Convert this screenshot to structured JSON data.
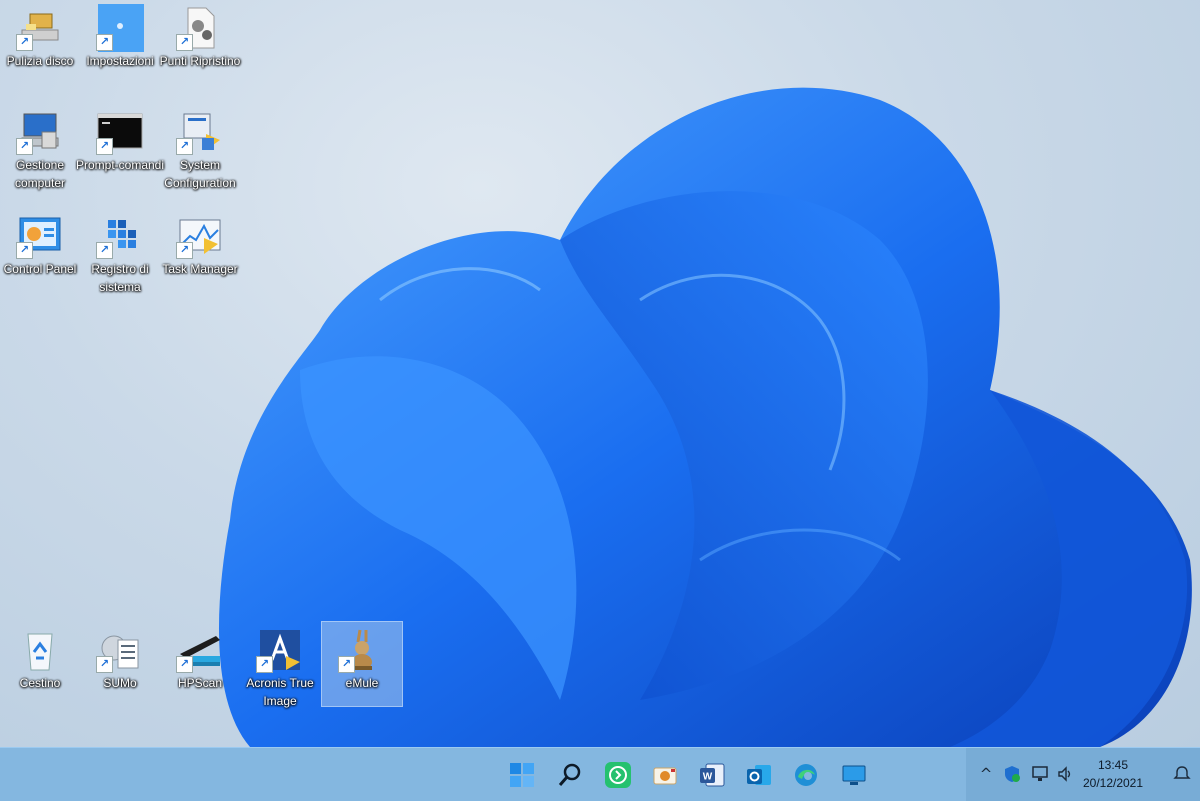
{
  "desktop": {
    "icons": [
      {
        "label": "Pulizia disco",
        "name": "disk-cleanup-icon"
      },
      {
        "label": "Impostazioni",
        "name": "settings-icon"
      },
      {
        "label": "Punti Ripristino",
        "name": "restore-points-icon"
      },
      {
        "label": "Gestione computer",
        "name": "computer-management-icon"
      },
      {
        "label": "Prompt-comandi",
        "name": "command-prompt-icon"
      },
      {
        "label": "System Configuration",
        "name": "system-configuration-icon"
      },
      {
        "label": "Control Panel",
        "name": "control-panel-icon"
      },
      {
        "label": "Registro di sistema",
        "name": "registry-editor-icon"
      },
      {
        "label": "Task Manager",
        "name": "task-manager-icon"
      },
      {
        "label": "Cestino",
        "name": "recycle-bin-icon"
      },
      {
        "label": "SUMo",
        "name": "sumo-icon"
      },
      {
        "label": "HPScan",
        "name": "hp-scan-icon"
      },
      {
        "label": "Acronis True Image",
        "name": "acronis-icon"
      },
      {
        "label": "eMule",
        "name": "emule-icon"
      }
    ],
    "shortcut_arrow": "↗"
  },
  "taskbar": {
    "apps": [
      "start-icon",
      "search-icon",
      "whatsapp-icon",
      "camera-app-icon",
      "word-icon",
      "outlook-icon",
      "edge-icon",
      "display-icon"
    ],
    "tray": {
      "chevron": "^",
      "time": "13:45",
      "date": "20/12/2021"
    }
  },
  "colors": {
    "taskbar": "#84b7e0",
    "accent": "#1d6fd6",
    "bloom": "#1a6ef0"
  }
}
